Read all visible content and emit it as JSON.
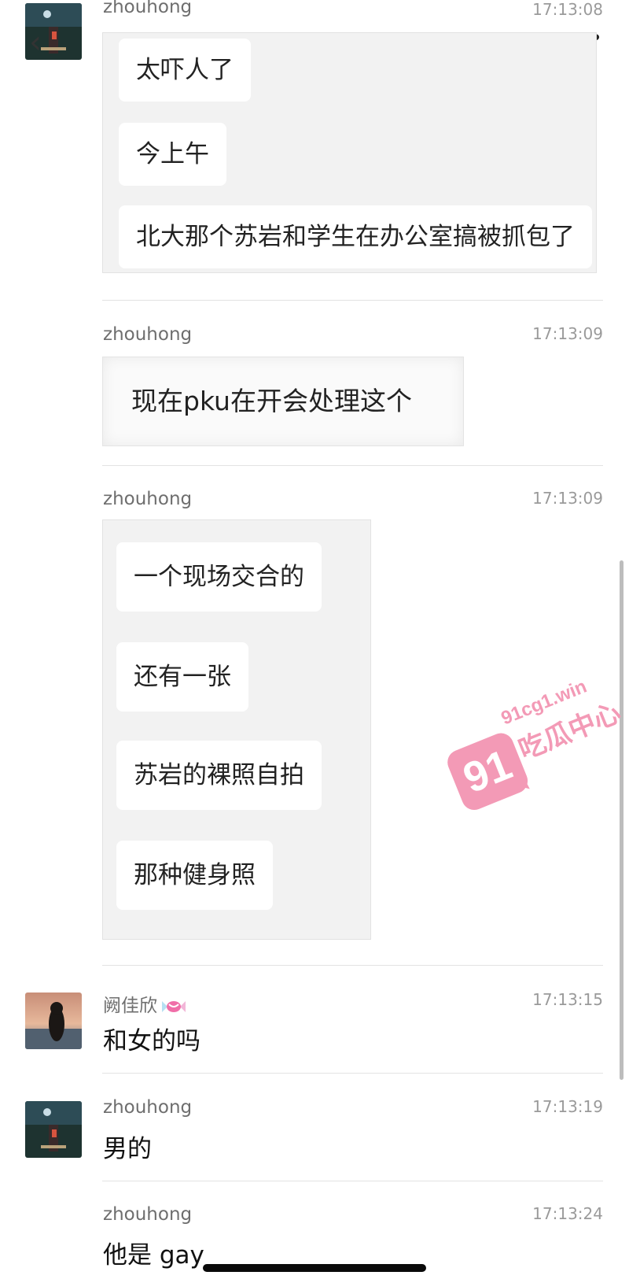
{
  "nav": {
    "back_icon": "chevron-left-icon",
    "more_icon": "more-dots-icon",
    "more_glyph": "•••"
  },
  "messages": [
    {
      "sender": "zhouhong",
      "time": "17:13:08",
      "items": [
        "太吓人了",
        "今上午",
        "北大那个苏岩和学生在办公室搞被抓包了"
      ]
    },
    {
      "sender": "zhouhong",
      "time": "17:13:09",
      "items": [
        "现在pku在开会处理这个"
      ]
    },
    {
      "sender": "zhouhong",
      "time": "17:13:09",
      "items": [
        "一个现场交合的",
        "还有一张",
        "苏岩的裸照自拍",
        "那种健身照"
      ]
    },
    {
      "sender": "阙佳欣",
      "time": "17:13:15",
      "text": "和女的吗"
    },
    {
      "sender": "zhouhong",
      "time": "17:13:19",
      "text": "男的"
    },
    {
      "sender": "zhouhong",
      "time": "17:13:24",
      "text": "他是 gay"
    }
  ],
  "watermark": {
    "logo_text": "91",
    "url": "91cg1.win",
    "name": "吃瓜中心",
    "color": "#f39ab6"
  }
}
